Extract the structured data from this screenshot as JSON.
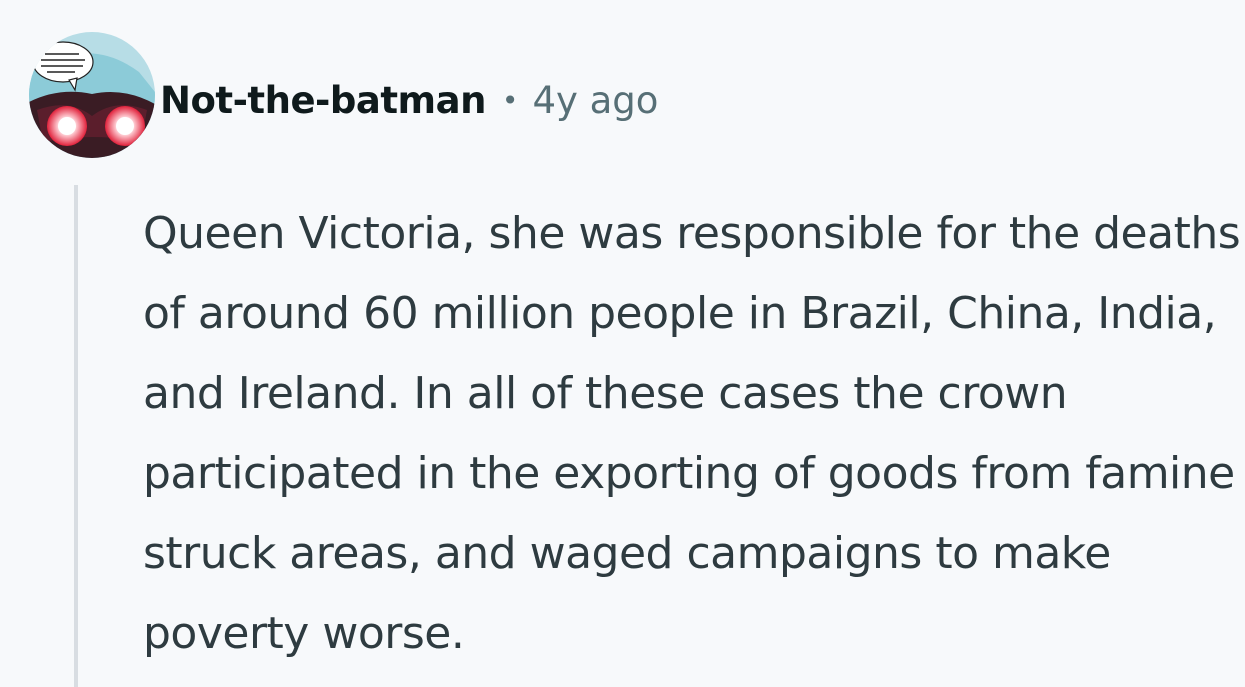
{
  "comment": {
    "avatar_icon": "comic-character-avatar-icon",
    "author": "Not-the-batman",
    "separator": "•",
    "timestamp": "4y ago",
    "body": "Queen Victoria, she was responsible for the deaths of around 60 million people in Brazil, China, India, and Ireland. In all of these cases the crown participated in the exporting of goods from famine struck areas, and waged campaigns to make poverty worse."
  },
  "colors": {
    "background": "#f7f9fb",
    "author": "#0f1a1c",
    "meta": "#576f76",
    "body_text": "#2e3b40",
    "thread_line": "#d8dde2"
  }
}
